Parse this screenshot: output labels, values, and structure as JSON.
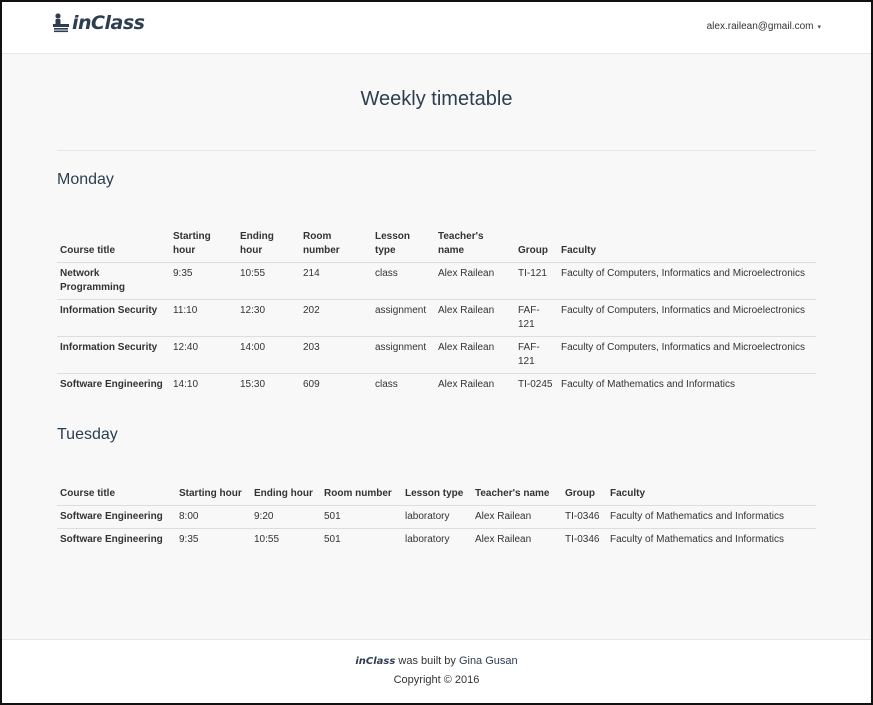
{
  "navbar": {
    "brand": "inClass",
    "user_email": "alex.railean@gmail.com"
  },
  "page": {
    "title": "Weekly timetable"
  },
  "days": [
    {
      "name": "Monday",
      "headers": [
        "Course title",
        "Starting hour",
        "Ending hour",
        "Room number",
        "Lesson type",
        "Teacher's name",
        "Group",
        "Faculty"
      ],
      "rows": [
        [
          "Network Programming",
          "9:35",
          "10:55",
          "214",
          "class",
          "Alex Railean",
          "TI-121",
          "Faculty of Computers, Informatics and Microelectronics"
        ],
        [
          "Information Security",
          "11:10",
          "12:30",
          "202",
          "assignment",
          "Alex Railean",
          "FAF-121",
          "Faculty of Computers, Informatics and Microelectronics"
        ],
        [
          "Information Security",
          "12:40",
          "14:00",
          "203",
          "assignment",
          "Alex Railean",
          "FAF-121",
          "Faculty of Computers, Informatics and Microelectronics"
        ],
        [
          "Software Engineering",
          "14:10",
          "15:30",
          "609",
          "class",
          "Alex Railean",
          "TI-0245",
          "Faculty of Mathematics and Informatics"
        ]
      ]
    },
    {
      "name": "Tuesday",
      "headers": [
        "Course title",
        "Starting hour",
        "Ending hour",
        "Room number",
        "Lesson type",
        "Teacher's name",
        "Group",
        "Faculty"
      ],
      "rows": [
        [
          "Software Engineering",
          "8:00",
          "9:20",
          "501",
          "laboratory",
          "Alex Railean",
          "TI-0346",
          "Faculty of Mathematics and Informatics"
        ],
        [
          "Software Engineering",
          "9:35",
          "10:55",
          "501",
          "laboratory",
          "Alex Railean",
          "TI-0346",
          "Faculty of Mathematics and Informatics"
        ]
      ]
    }
  ],
  "footer": {
    "brand": "inClass",
    "built_by_text": "was built by",
    "author": "Gina Gusan",
    "copyright": "Copyright © 2016"
  }
}
